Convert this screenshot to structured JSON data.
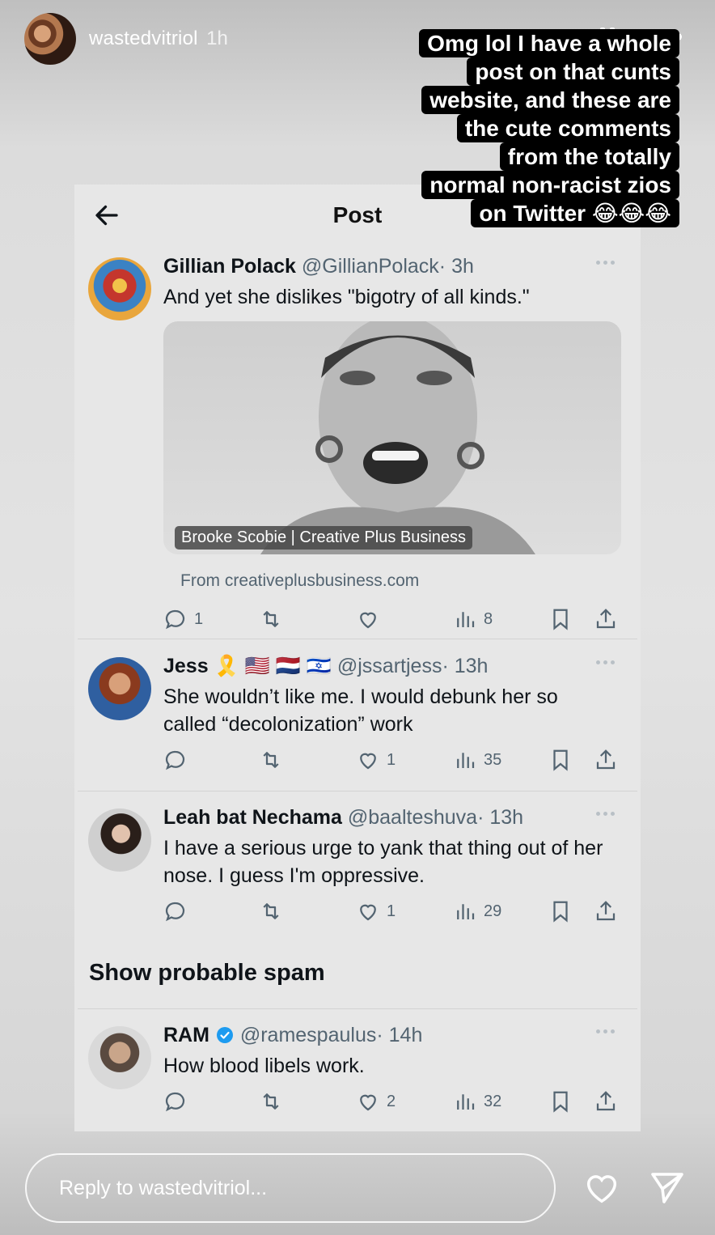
{
  "story": {
    "username": "wastedvitriol",
    "time": "1h",
    "caption_lines": [
      "Omg lol I have a whole",
      "post on that cunts",
      "website, and these are",
      "the cute comments",
      "from the totally",
      "normal non-racist zios",
      "on Twitter 😂😂😂"
    ]
  },
  "post_header": {
    "title": "Post"
  },
  "tweets": [
    {
      "name": "Gillian Polack",
      "handle": "@GillianPolack",
      "time": "· 3h",
      "text": "And yet she dislikes \"bigotry of all kinds.\"",
      "media_label": "Brooke Scobie | Creative Plus Business",
      "media_source": "From creativeplusbusiness.com",
      "replies": "1",
      "retweets": "",
      "likes": "",
      "views": "8"
    },
    {
      "name": "Jess 🎗️ 🇺🇸 🇳🇱 🇮🇱",
      "handle": "@jssartjess",
      "time": "· 13h",
      "text": "She wouldn’t like me. I would debunk her so called “decolonization” work",
      "replies": "",
      "retweets": "",
      "likes": "1",
      "views": "35"
    },
    {
      "name": "Leah bat Nechama",
      "handle": "@baalteshuva",
      "time": "· 13h",
      "text": "I have a serious urge to yank that thing out of her nose. I guess I'm oppressive.",
      "replies": "",
      "retweets": "",
      "likes": "1",
      "views": "29"
    },
    {
      "name": "RAM",
      "handle": "@ramespaulus",
      "time": "· 14h",
      "text": "How blood libels work.",
      "replies": "",
      "retweets": "",
      "likes": "2",
      "views": "32"
    }
  ],
  "spam_section": {
    "label": "Show probable spam"
  },
  "reply": {
    "placeholder": "Reply to wastedvitriol..."
  },
  "colors": {
    "verified": "#1d9bf0",
    "caption_bg": "#000000",
    "muted": "#536471"
  }
}
